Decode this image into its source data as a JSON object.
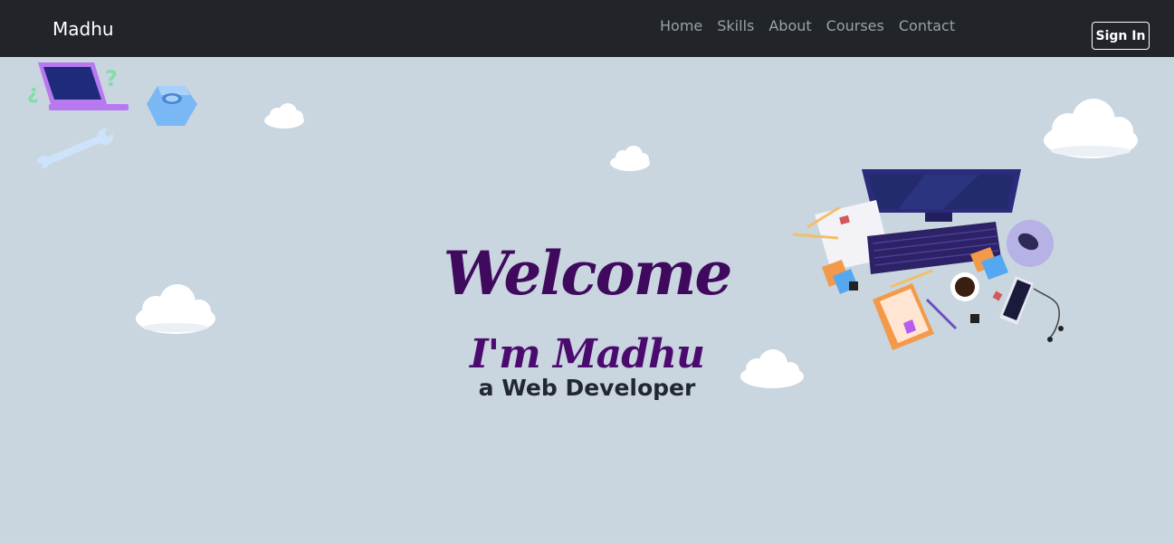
{
  "navbar": {
    "brand": "Madhu",
    "links": [
      "Home",
      "Skills",
      "About",
      "Courses",
      "Contact"
    ],
    "signin_label": "Sign In"
  },
  "hero": {
    "welcome": "Welcome",
    "intro": "I'm Madhu",
    "role": "a Web Developer"
  },
  "colors": {
    "navbar_bg": "#212529",
    "page_bg": "#c9d5df",
    "heading": "#3f0a5e",
    "role_text": "#222831"
  },
  "illustrations": {
    "top_left": "laptop-wrench-nut-icons",
    "right": "desk-workspace-computer-illustration",
    "clouds": "cloud-icon"
  }
}
